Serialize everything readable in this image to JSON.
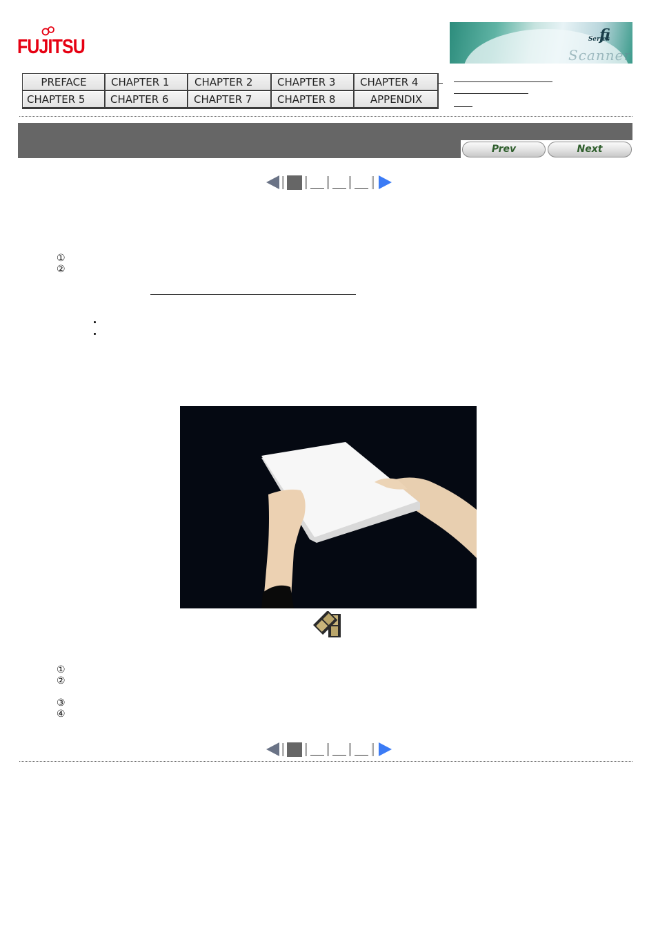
{
  "brand": {
    "logo_text": "FUJITSU",
    "logo_color": "#e60012",
    "banner": {
      "fi": "fi",
      "series": "Series",
      "scanner": "Image Scanner"
    }
  },
  "nav": {
    "rows": [
      [
        "PREFACE",
        "CHAPTER 1",
        "CHAPTER 2",
        "CHAPTER 3",
        "CHAPTER 4"
      ],
      [
        "CHAPTER 5",
        "CHAPTER 6",
        "CHAPTER 7",
        "CHAPTER 8",
        "APPENDIX"
      ]
    ]
  },
  "right_links": [
    "",
    "",
    ""
  ],
  "titlebar": {
    "bg": "#666666",
    "prev_label": "Prev",
    "next_label": "Next"
  },
  "pager": {
    "current_page": 1,
    "total_pages": 4,
    "prev_icon": "triangle-left-icon",
    "next_icon": "triangle-right-icon"
  },
  "steps_top": [
    "①",
    "②"
  ],
  "bullets_count": 2,
  "photo": {
    "description": "Hands holding a stack of white paper against a black background",
    "video_icon": "film-icon"
  },
  "steps_bottom": [
    "①",
    "②",
    "③",
    "④"
  ]
}
